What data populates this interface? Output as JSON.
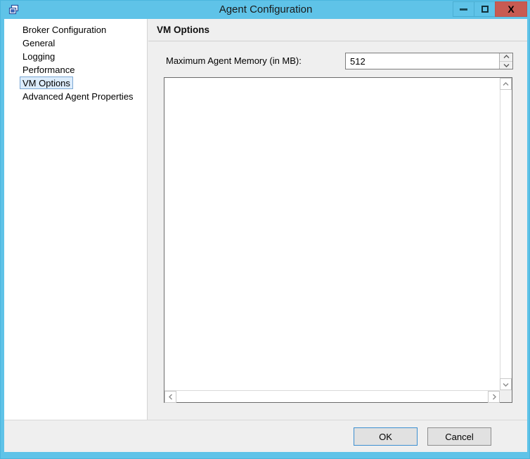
{
  "window": {
    "title": "Agent Configuration",
    "icon": "cascading-windows-icon",
    "titlebar_color": "#5fc3e8",
    "close_button_color": "#c85b52",
    "controls": {
      "minimize_label": "–",
      "maximize_label": "□",
      "close_label": "X"
    }
  },
  "sidebar": {
    "items": [
      {
        "label": "Broker Configuration",
        "selected": false
      },
      {
        "label": "General",
        "selected": false
      },
      {
        "label": "Logging",
        "selected": false
      },
      {
        "label": "Performance",
        "selected": false
      },
      {
        "label": "VM Options",
        "selected": true
      },
      {
        "label": "Advanced Agent Properties",
        "selected": false
      }
    ],
    "selection_fill": "#dcecfb",
    "selection_border": "#7ca8d4"
  },
  "content": {
    "header": "VM Options",
    "memory_field": {
      "label": "Maximum Agent Memory (in MB):",
      "value": "512",
      "placeholder": "",
      "spin_up": "▲",
      "spin_down": "▼"
    },
    "options_textarea": {
      "value": "",
      "placeholder": ""
    },
    "scrollbars": {
      "up_arrow": "⌃",
      "down_arrow": "⌄",
      "left_arrow": "‹",
      "right_arrow": "›"
    }
  },
  "footer": {
    "ok_label": "OK",
    "cancel_label": "Cancel",
    "ok_focus_border": "#3c8fd0"
  }
}
